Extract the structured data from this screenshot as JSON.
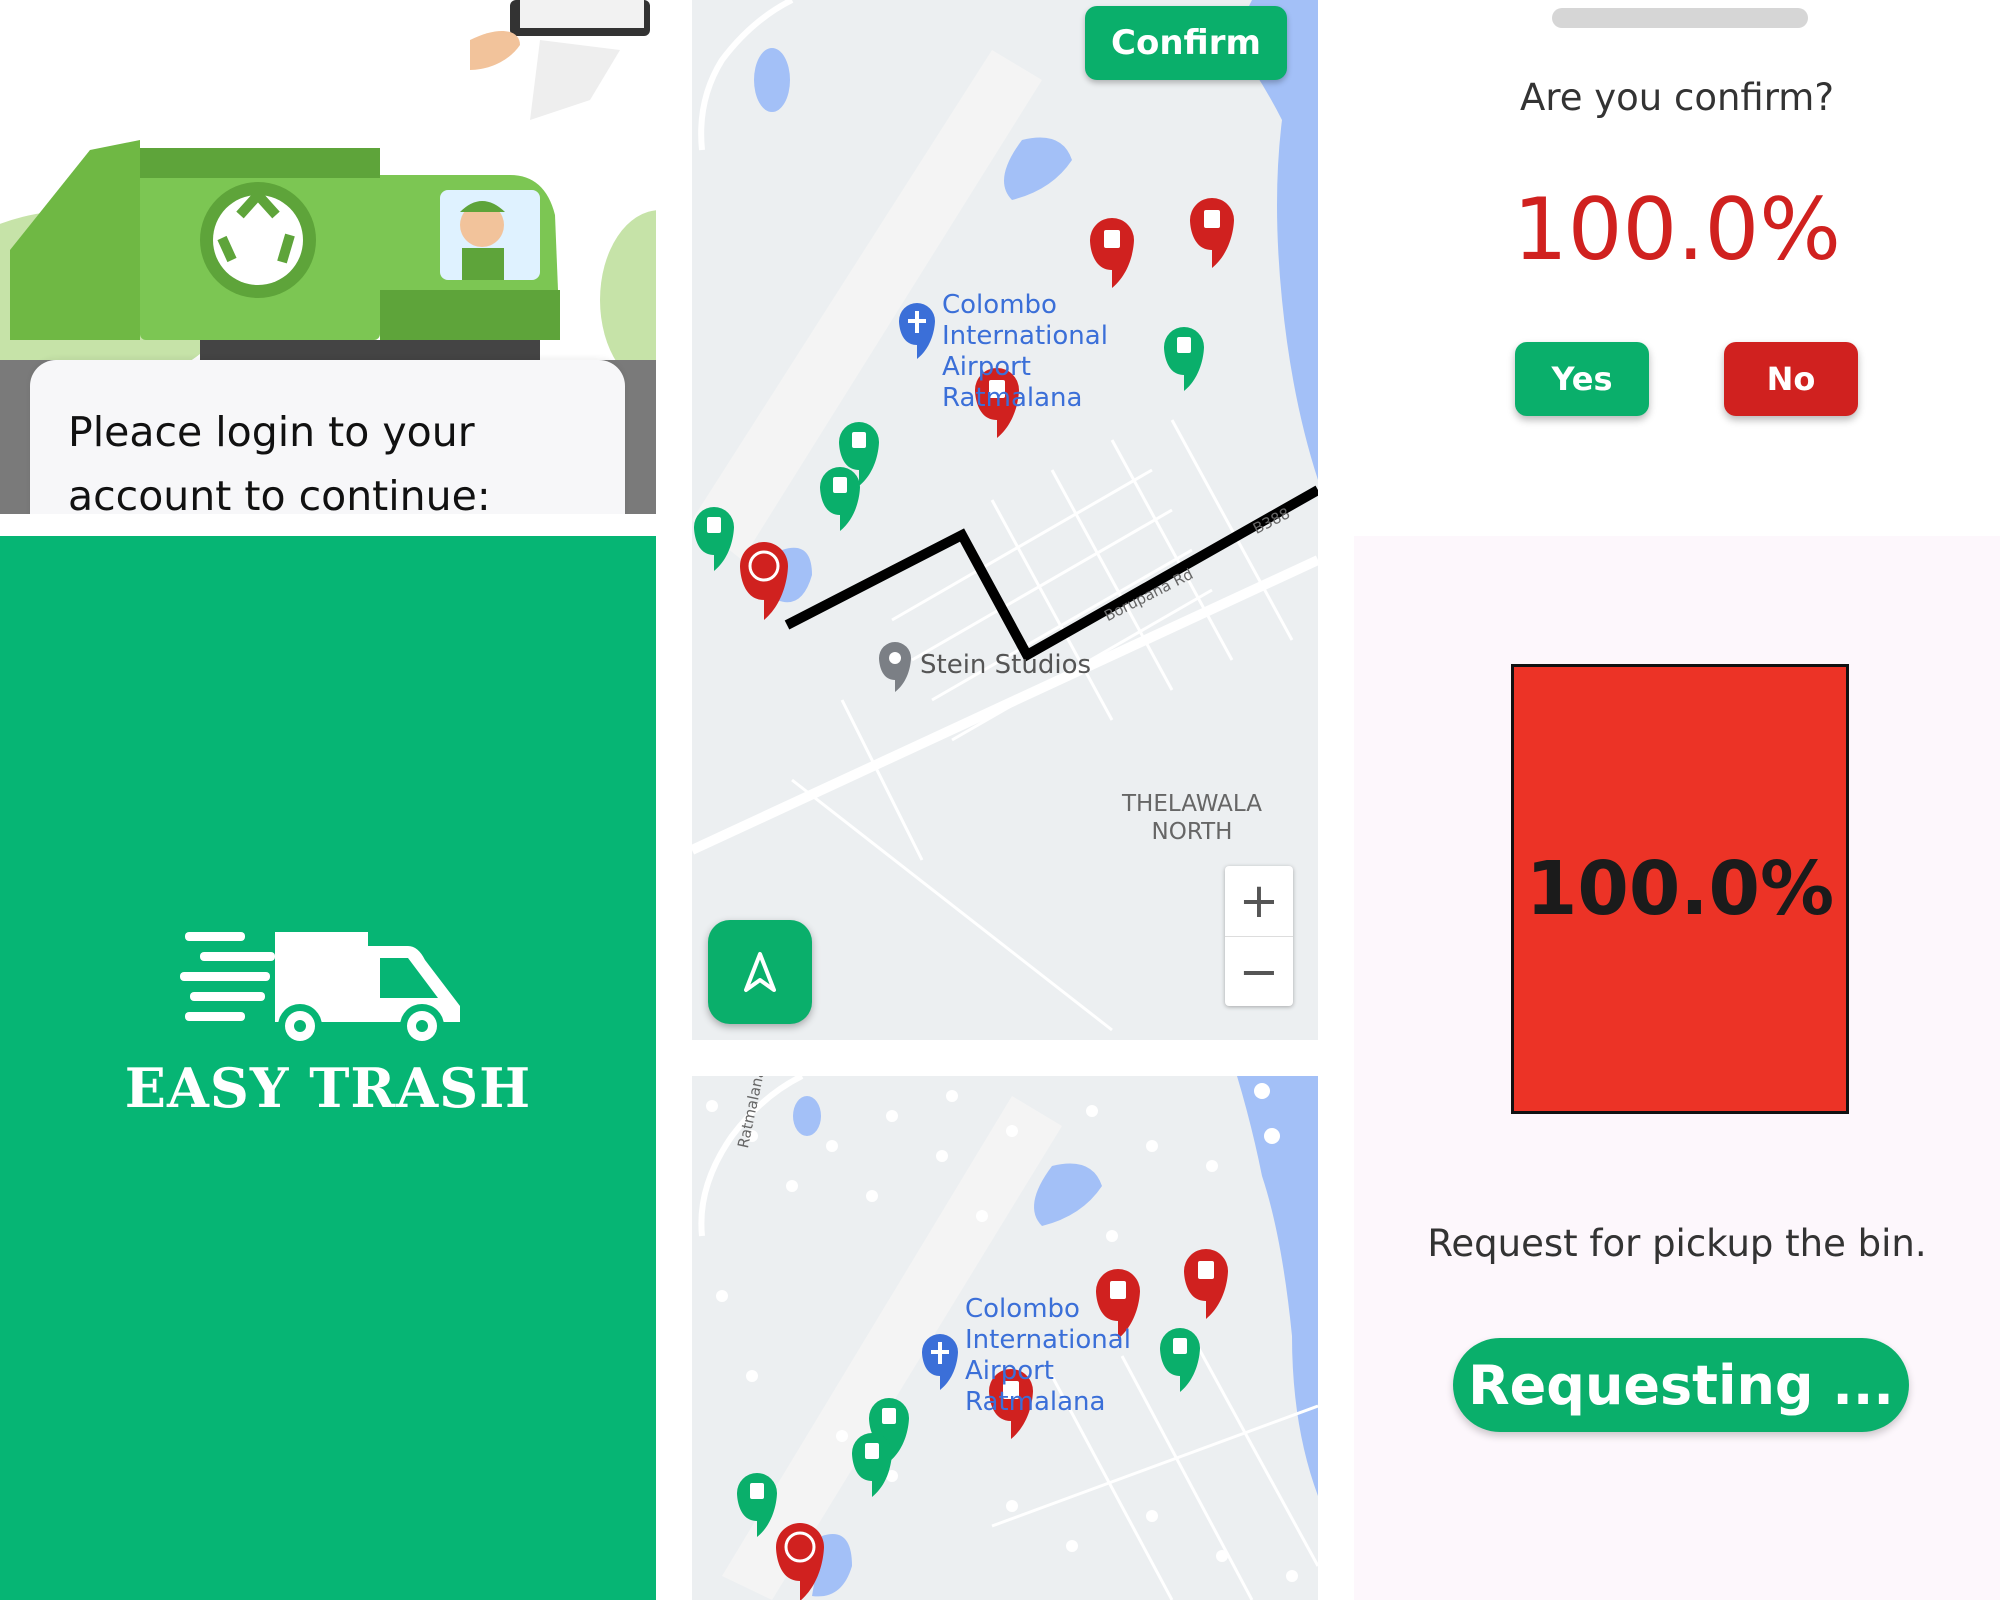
{
  "login": {
    "prompt": "Pleace login to your account to continue:"
  },
  "splash": {
    "brand": "EASY TRASH",
    "bg_color": "#06b574"
  },
  "map": {
    "confirm_label": "Confirm",
    "airport_label": "Colombo International Airport Ratmalana",
    "place_label": "Stein Studios",
    "area_label_line1": "THELAWALA",
    "area_label_line2": "NORTH",
    "road_label_1": "Borupana Rd",
    "road_label_2": "B388",
    "road_label_3": "Ratmalana - Attidiya",
    "zoom_in": "+",
    "zoom_out": "−",
    "start_marker": "S",
    "icons": [
      "bin-marker-red",
      "bin-marker-green",
      "start-marker",
      "airport-icon",
      "place-pin-icon",
      "navigation-icon"
    ],
    "colors": {
      "full_bin": "#d0211f",
      "empty_bin": "#0aaf6b",
      "route": "#000000",
      "water": "#a3c0f7"
    }
  },
  "confirm_dialog": {
    "question": "Are you confirm?",
    "percent": "100.0%",
    "yes_label": "Yes",
    "no_label": "No"
  },
  "request": {
    "bin_percent": "100.0%",
    "message": "Request for pickup the bin.",
    "button_label": "Requesting ...",
    "bin_color": "#ec3326"
  }
}
